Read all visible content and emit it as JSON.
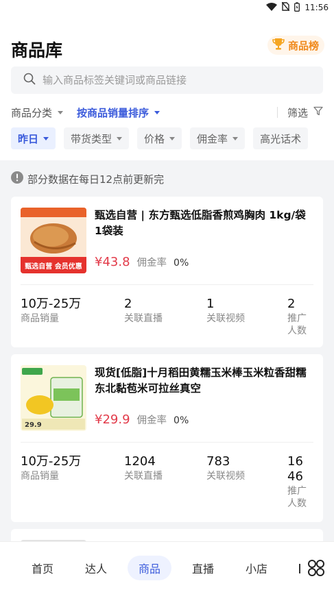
{
  "status_bar": {
    "time": "11:56",
    "icons": [
      "wifi-icon",
      "no-sim-icon",
      "battery-icon"
    ]
  },
  "header": {
    "title": "商品库",
    "rank_button": "商品榜"
  },
  "search": {
    "placeholder": "输入商品标签关键词或商品链接"
  },
  "filters": {
    "category": "商品分类",
    "sort": "按商品销量排序",
    "screen": "筛选"
  },
  "chips": [
    {
      "label": "昨日",
      "has_caret": true,
      "active": true
    },
    {
      "label": "带货类型",
      "has_caret": true,
      "active": false
    },
    {
      "label": "价格",
      "has_caret": true,
      "active": false
    },
    {
      "label": "佣金率",
      "has_caret": true,
      "active": false
    },
    {
      "label": "高光话术",
      "has_caret": false,
      "active": false
    }
  ],
  "notice": "部分数据在每日12点前更新完",
  "products": [
    {
      "title": "甄选自营 | 东方甄选低脂香煎鸡胸肉 1kg/袋 1袋装",
      "price": "¥43.8",
      "commission_label": "佣金率",
      "commission": "0%",
      "thumb_caption": "甄选自营 会员优惠",
      "stats": [
        {
          "value": "10万-25万",
          "label": "商品销量"
        },
        {
          "value": "2",
          "label": "关联直播"
        },
        {
          "value": "1",
          "label": "关联视频"
        },
        {
          "value": "2",
          "label": "推广人数"
        }
      ]
    },
    {
      "title": "现货[低脂]十月稻田黄糯玉米棒玉米粒香甜糯东北黏苞米可拉丝真空",
      "price": "¥29.9",
      "commission_label": "佣金率",
      "commission": "0%",
      "thumb_caption": "29.9",
      "stats": [
        {
          "value": "10万-25万",
          "label": "商品销量"
        },
        {
          "value": "1204",
          "label": "关联直播"
        },
        {
          "value": "783",
          "label": "关联视频"
        },
        {
          "value": "1646",
          "label": "推广人数"
        }
      ]
    }
  ],
  "bottom_nav": [
    {
      "label": "首页",
      "active": false
    },
    {
      "label": "达人",
      "active": false
    },
    {
      "label": "商品",
      "active": true
    },
    {
      "label": "直播",
      "active": false
    },
    {
      "label": "小店",
      "active": false
    }
  ],
  "colors": {
    "accent": "#3b5bdb",
    "price": "#e23b4a",
    "rank": "#f08a1d"
  }
}
